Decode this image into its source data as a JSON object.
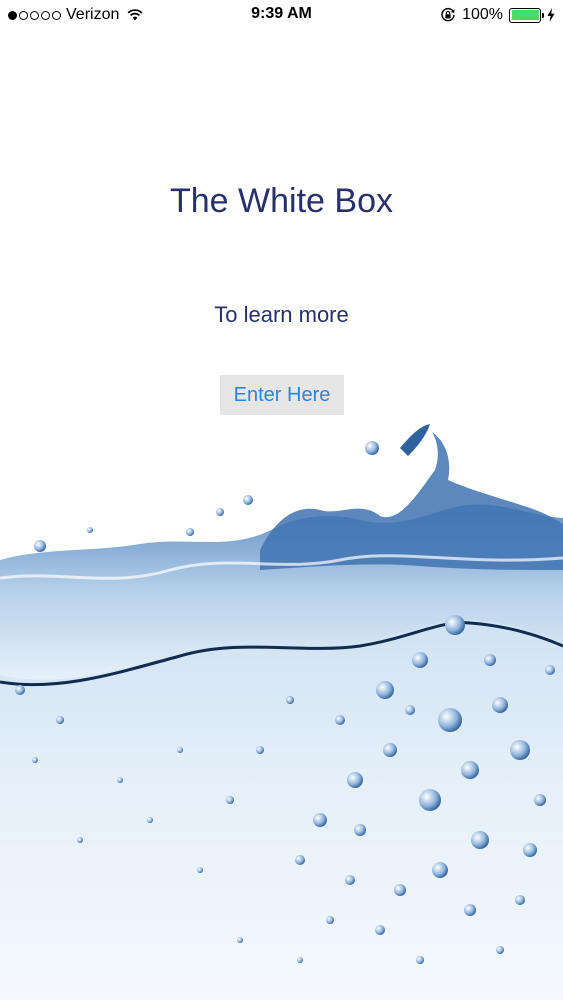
{
  "status_bar": {
    "carrier": "Verizon",
    "time": "9:39 AM",
    "battery_percent": "100%",
    "signal_bars_filled": 1,
    "signal_bars_total": 5,
    "battery_level": 1.0
  },
  "main": {
    "title": "The White Box",
    "subtitle": "To learn more",
    "enter_label": "Enter Here"
  },
  "colors": {
    "title": "#27306b",
    "button_text": "#2a86e0",
    "button_bg": "#e6e6e6",
    "battery": "#4cd964"
  },
  "icons": [
    "wifi-icon",
    "orientation-lock-icon",
    "battery-icon",
    "charging-bolt-icon"
  ]
}
